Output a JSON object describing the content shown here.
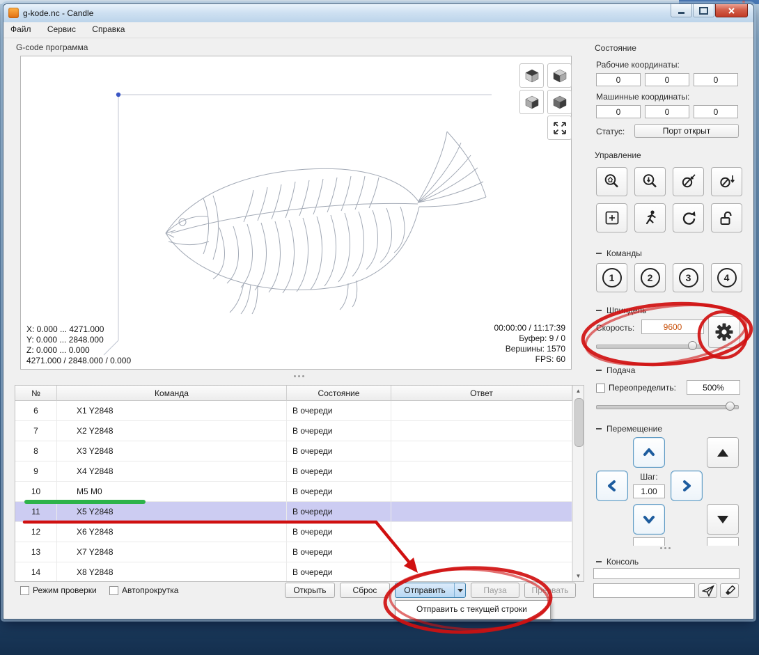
{
  "window": {
    "title": "g-kode.nc - Candle"
  },
  "menu": {
    "items": [
      "Файл",
      "Сервис",
      "Справка"
    ]
  },
  "gcode_group": {
    "title": "G-code программа"
  },
  "visualizer": {
    "info_left": [
      "X: 0.000 ... 4271.000",
      "Y: 0.000 ... 2848.000",
      "Z: 0.000 ... 0.000",
      "4271.000 / 2848.000 / 0.000"
    ],
    "info_right": [
      "00:00:00 / 11:17:39",
      "Буфер: 9 / 0",
      "Вершины: 1570",
      "FPS: 60"
    ]
  },
  "table": {
    "headers": [
      "№",
      "Команда",
      "Состояние",
      "Ответ"
    ],
    "selected_line": "11",
    "rows": [
      {
        "n": "6",
        "cmd": "X1 Y2848",
        "state": "В очереди",
        "resp": ""
      },
      {
        "n": "7",
        "cmd": "X2 Y2848",
        "state": "В очереди",
        "resp": ""
      },
      {
        "n": "8",
        "cmd": "X3 Y2848",
        "state": "В очереди",
        "resp": ""
      },
      {
        "n": "9",
        "cmd": "X4 Y2848",
        "state": "В очереди",
        "resp": ""
      },
      {
        "n": "10",
        "cmd": "M5 M0",
        "state": "В очереди",
        "resp": ""
      },
      {
        "n": "11",
        "cmd": "X5 Y2848",
        "state": "В очереди",
        "resp": ""
      },
      {
        "n": "12",
        "cmd": "X6 Y2848",
        "state": "В очереди",
        "resp": ""
      },
      {
        "n": "13",
        "cmd": "X7 Y2848",
        "state": "В очереди",
        "resp": ""
      },
      {
        "n": "14",
        "cmd": "X8 Y2848",
        "state": "В очереди",
        "resp": ""
      }
    ]
  },
  "bottom_bar": {
    "check_mode": "Режим проверки",
    "check_autoscroll": "Автопрокрутка",
    "open": "Открыть",
    "reset": "Сброс",
    "send": "Отправить",
    "pause": "Пауза",
    "abort": "Прервать"
  },
  "send_menu": {
    "item": "Отправить с текущей строки"
  },
  "state_panel": {
    "title": "Состояние",
    "work_coords_label": "Рабочие координаты:",
    "work_coords": [
      "0",
      "0",
      "0"
    ],
    "machine_coords_label": "Машинные координаты:",
    "machine_coords": [
      "0",
      "0",
      "0"
    ],
    "status_label": "Статус:",
    "status_value": "Порт открыт"
  },
  "control_panel": {
    "title": "Управление"
  },
  "commands_panel": {
    "title": "Команды",
    "buttons": [
      "1",
      "2",
      "3",
      "4"
    ]
  },
  "spindle_panel": {
    "title": "Шпиндель",
    "speed_label": "Скорость:",
    "speed_value": "9600",
    "speed_color": "#c8500a"
  },
  "feed_panel": {
    "title": "Подача",
    "override_label": "Переопределить:",
    "override_value": "500%"
  },
  "jog_panel": {
    "title": "Перемещение",
    "step_label": "Шаг:",
    "step_value": "1.00"
  },
  "console_panel": {
    "title": "Консоль",
    "input_value": ""
  },
  "annotations": {
    "red": "#d01010",
    "green": "#2db34a"
  }
}
